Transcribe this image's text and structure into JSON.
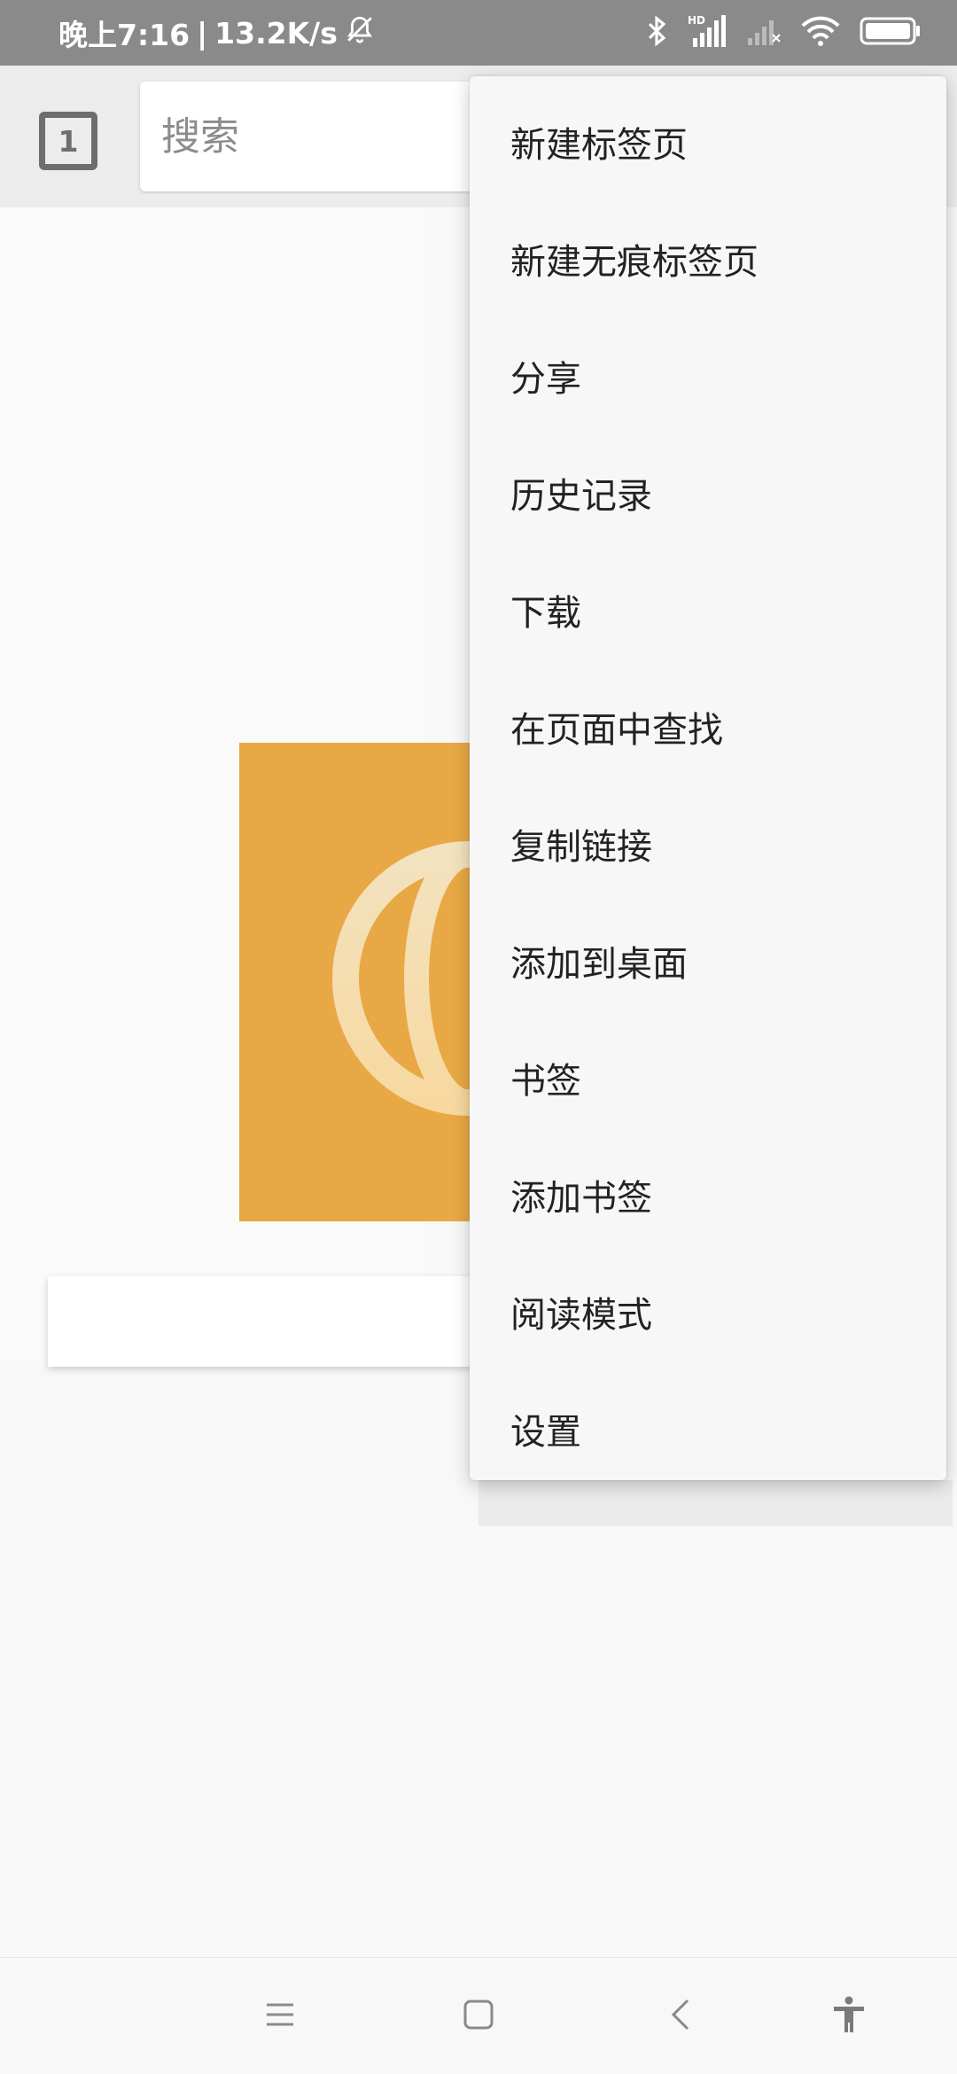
{
  "status_bar": {
    "time": "晚上7:16",
    "separator": "|",
    "speed": "13.2K/s",
    "icons": [
      "bell-off-icon",
      "bluetooth-icon",
      "hd-signal-icon",
      "signal-icon",
      "wifi-icon",
      "battery-icon"
    ]
  },
  "toolbar": {
    "tab_count": "1",
    "search_placeholder": "搜索"
  },
  "menu": {
    "items": [
      {
        "label": "新建标签页"
      },
      {
        "label": "新建无痕标签页"
      },
      {
        "label": "分享"
      },
      {
        "label": "历史记录"
      },
      {
        "label": "下载"
      },
      {
        "label": "在页面中查找"
      },
      {
        "label": "复制链接"
      },
      {
        "label": "添加到桌面"
      },
      {
        "label": "书签"
      },
      {
        "label": "添加书签"
      },
      {
        "label": "阅读模式"
      },
      {
        "label": "设置"
      }
    ]
  },
  "site_tile": {
    "color": "#e8a845",
    "icon": "globe-icon"
  },
  "nav_bar": {
    "icons": [
      "menu-icon",
      "home-icon",
      "back-icon",
      "accessibility-icon"
    ]
  }
}
